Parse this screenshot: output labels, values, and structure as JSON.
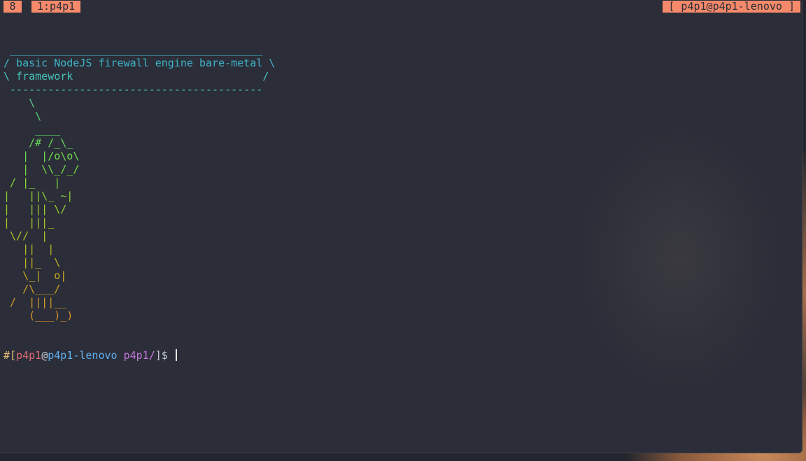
{
  "tmux": {
    "window_number": "8",
    "session_name": "1:p4p1",
    "host_label": "[ p4p1@p4p1-lenovo ]"
  },
  "ascii_art": [
    {
      "text": " ________________________________________",
      "color": "#3aa9c4"
    },
    {
      "text": "/ basic NodeJS firewall engine bare-metal \\",
      "color": "#3fb5c9"
    },
    {
      "text": "\\ framework                              /",
      "color": "#44c2b9"
    },
    {
      "text": " ----------------------------------------",
      "color": "#4bcaa6"
    },
    {
      "text": "    \\",
      "color": "#52d08f"
    },
    {
      "text": "     \\",
      "color": "#58d47c"
    },
    {
      "text": "     ____",
      "color": "#5fd86a"
    },
    {
      "text": "    /# /_\\_",
      "color": "#67d95a"
    },
    {
      "text": "   |  |/o\\o\\",
      "color": "#70da4d"
    },
    {
      "text": "   |  \\\\_/_/",
      "color": "#7ad943"
    },
    {
      "text": " / |_   |",
      "color": "#85d63b"
    },
    {
      "text": "|   ||\\_ ~|",
      "color": "#90d234"
    },
    {
      "text": "|   ||| \\/",
      "color": "#9bcd2e"
    },
    {
      "text": "|   |||_",
      "color": "#a6c72a"
    },
    {
      "text": " \\//  |",
      "color": "#b0c027"
    },
    {
      "text": "   ||  |",
      "color": "#bab825"
    },
    {
      "text": "   ||_  \\",
      "color": "#c2b024"
    },
    {
      "text": "   \\_|  o|",
      "color": "#c9a823"
    },
    {
      "text": "   /\\___/",
      "color": "#cfa024"
    },
    {
      "text": " /  ||||__",
      "color": "#d49826"
    },
    {
      "text": "    (___)_)",
      "color": "#d89029"
    }
  ],
  "prompt": {
    "open": "#[",
    "user": "p4p1",
    "at": "@",
    "host": "p4p1-lenovo",
    "space": " ",
    "path": "p4p1/",
    "close": "]$ ",
    "colors": {
      "bracket": "#e6c07b",
      "user": "#e06c75",
      "at": "#c8ccd4",
      "host": "#61afef",
      "path": "#c678dd",
      "close": "#c8ccd4"
    }
  }
}
